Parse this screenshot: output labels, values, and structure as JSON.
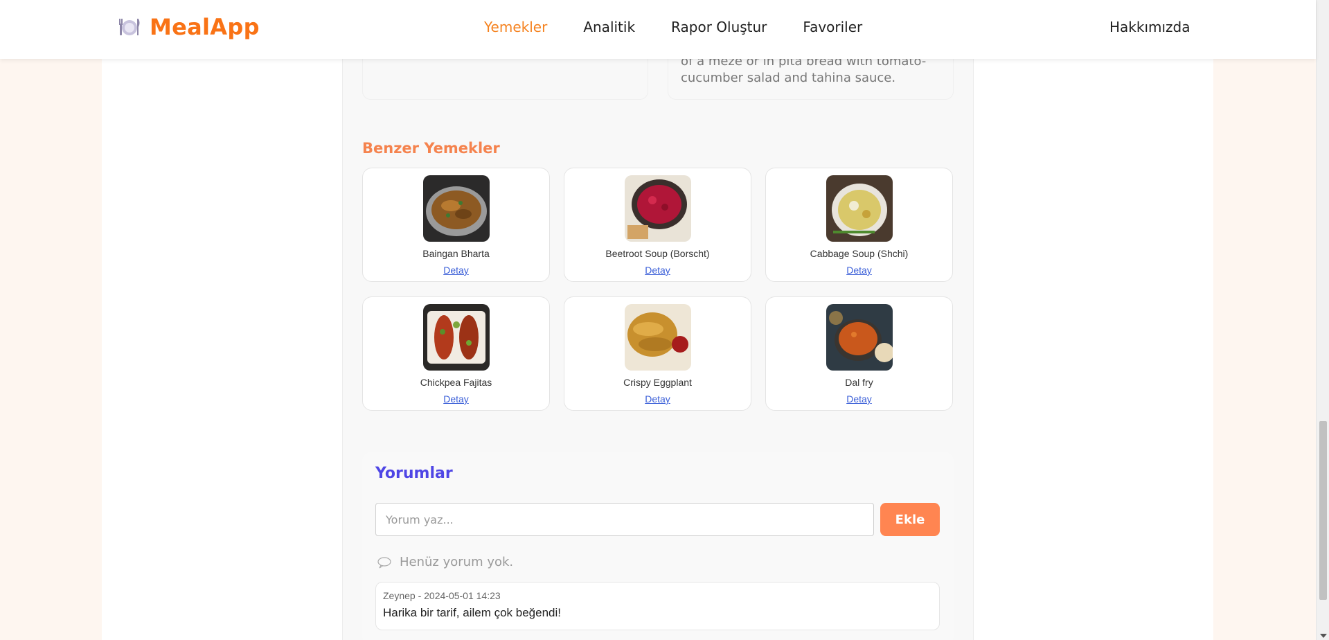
{
  "brand": {
    "name": "MealApp",
    "icon": "plate-cutlery-icon",
    "color": "#f97316"
  },
  "nav": {
    "items": [
      {
        "label": "Yemekler",
        "active": true
      },
      {
        "label": "Analitik",
        "active": false
      },
      {
        "label": "Rapor Oluştur",
        "active": false
      },
      {
        "label": "Favoriler",
        "active": false
      }
    ],
    "about": "Hakkımızda",
    "active_color": "#f5821f"
  },
  "description": {
    "right_text": "of a meze or in pita bread with tomato-cucumber salad and tahina sauce."
  },
  "similar": {
    "title": "Benzer Yemekler",
    "link_label": "Detay",
    "items": [
      {
        "name": "Baingan Bharta",
        "link": "Detay"
      },
      {
        "name": "Beetroot Soup (Borscht)",
        "link": "Detay"
      },
      {
        "name": "Cabbage Soup (Shchi)",
        "link": "Detay"
      },
      {
        "name": "Chickpea Fajitas",
        "link": "Detay"
      },
      {
        "name": "Crispy Eggplant",
        "link": "Detay"
      },
      {
        "name": "Dal fry",
        "link": "Detay"
      }
    ]
  },
  "comments": {
    "title": "Yorumlar",
    "input_placeholder": "Yorum yaz...",
    "input_value": "",
    "add_label": "Ekle",
    "empty_text": "Henüz yorum yok.",
    "list": [
      {
        "meta": "Zeynep - 2024-05-01 14:23",
        "text": "Harika bir tarif, ailem çok beğendi!"
      }
    ],
    "title_color": "#4f46e5",
    "button_color": "#ff8551"
  }
}
